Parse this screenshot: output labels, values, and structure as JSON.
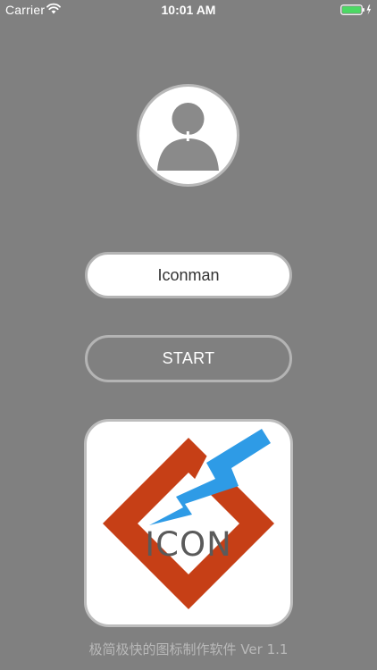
{
  "status_bar": {
    "carrier": "Carrier",
    "time": "10:01 AM",
    "battery_color": "#4cd964"
  },
  "profile": {
    "avatar_icon": "person-add-icon",
    "name_value": "Iconman"
  },
  "actions": {
    "start_label": "START"
  },
  "logo": {
    "text": "ICON",
    "diamond_color": "#c63f16",
    "bolt_color": "#2e9be6"
  },
  "footer": {
    "text": "极简极快的图标制作软件 Ver 1.1"
  },
  "colors": {
    "background": "#808080",
    "border": "#b4b4b4",
    "text_light": "#ffffff",
    "footer_text": "#b9b9b9"
  }
}
